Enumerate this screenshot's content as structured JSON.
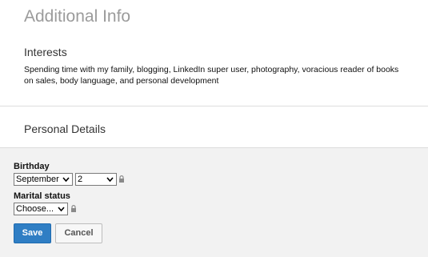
{
  "page": {
    "title": "Additional Info"
  },
  "interests": {
    "heading": "Interests",
    "text": "Spending time with my family, blogging, LinkedIn super user, photography, voracious reader of books on sales, body language, and personal development"
  },
  "personal_details": {
    "heading": "Personal Details",
    "birthday": {
      "label": "Birthday",
      "month": "September",
      "day": "2"
    },
    "marital_status": {
      "label": "Marital status",
      "value": "Choose..."
    }
  },
  "actions": {
    "save_label": "Save",
    "cancel_label": "Cancel"
  },
  "colors": {
    "accent": "#2f7ec4",
    "form_background": "#f2f2f2",
    "title_gray": "#9b9b9b"
  },
  "icons": {
    "select_arrow": "chevron-down-icon",
    "privacy": "lock-icon"
  }
}
